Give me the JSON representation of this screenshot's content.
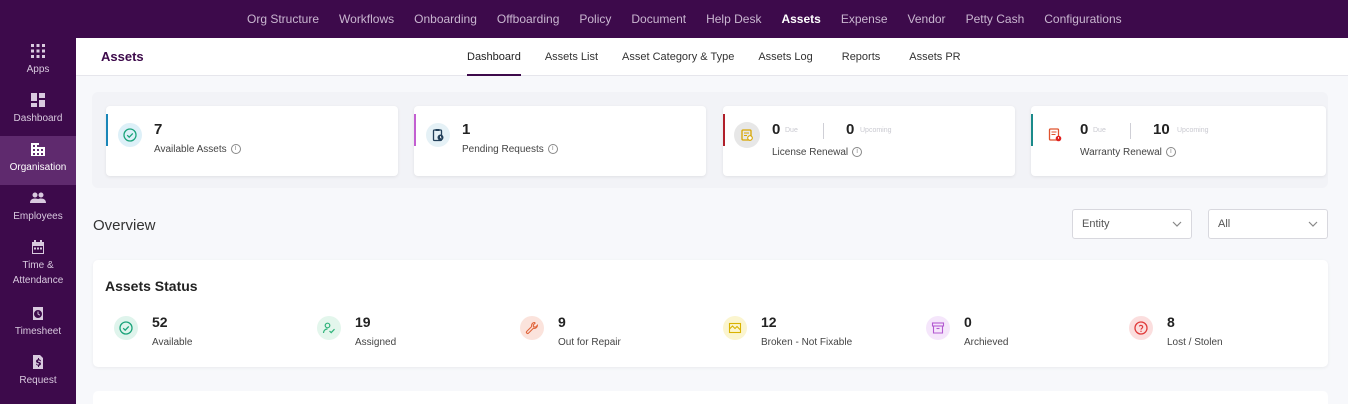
{
  "topnav": {
    "items": [
      "Org Structure",
      "Workflows",
      "Onboarding",
      "Offboarding",
      "Policy",
      "Document",
      "Help Desk",
      "Assets",
      "Expense",
      "Vendor",
      "Petty Cash",
      "Configurations"
    ],
    "active": "Assets"
  },
  "sidebar": {
    "items": [
      {
        "label": "Apps",
        "icon": "apps-grid-icon"
      },
      {
        "label": "Dashboard",
        "icon": "dashboard-icon"
      },
      {
        "label": "Organisation",
        "icon": "building-icon"
      },
      {
        "label": "Employees",
        "icon": "people-icon"
      },
      {
        "label": "Time &",
        "label2": "Attendance",
        "icon": "calendar-icon"
      },
      {
        "label": "Timesheet",
        "icon": "timesheet-icon"
      },
      {
        "label": "Request",
        "icon": "request-icon"
      }
    ],
    "active": "Organisation"
  },
  "page": {
    "title": "Assets",
    "tabs": [
      "Dashboard",
      "Assets List",
      "Asset Category & Type",
      "Assets Log",
      "Reports",
      "Assets PR"
    ],
    "active_tab": "Dashboard"
  },
  "summary": {
    "available": {
      "value": "7",
      "label": "Available Assets"
    },
    "pending": {
      "value": "1",
      "label": "Pending Requests"
    },
    "license": {
      "due": "0",
      "due_label": "Due",
      "upcoming": "0",
      "upcoming_label": "Upcoming",
      "label": "License Renewal"
    },
    "warranty": {
      "due": "0",
      "due_label": "Due",
      "upcoming": "10",
      "upcoming_label": "Upcoming",
      "label": "Warranty Renewal"
    }
  },
  "overview": {
    "title": "Overview",
    "entity_select": "Entity",
    "all_select": "All"
  },
  "status": {
    "title": "Assets Status",
    "items": [
      {
        "value": "52",
        "label": "Available",
        "color": "#1aa37a",
        "bg": "#dff4ec"
      },
      {
        "value": "19",
        "label": "Assigned",
        "color": "#2fb37a",
        "bg": "#e3f6ec"
      },
      {
        "value": "9",
        "label": "Out for Repair",
        "color": "#e0643a",
        "bg": "#fbe3dc"
      },
      {
        "value": "12",
        "label": "Broken - Not Fixable",
        "color": "#d9b200",
        "bg": "#fbf5cf"
      },
      {
        "value": "0",
        "label": "Archieved",
        "color": "#b35ad1",
        "bg": "#f5e6fb"
      },
      {
        "value": "8",
        "label": "Lost / Stolen",
        "color": "#e03a3a",
        "bg": "#fbdede"
      }
    ]
  },
  "colors": {
    "brand": "#3d0a4b",
    "sidebar_active": "#5f2a6e"
  }
}
